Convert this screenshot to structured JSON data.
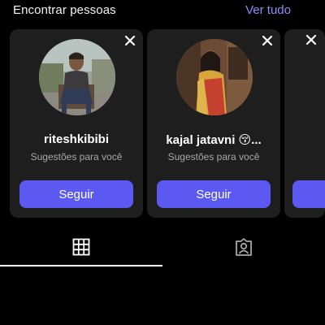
{
  "header": {
    "title": "Encontrar pessoas",
    "see_all": "Ver tudo"
  },
  "suggestions": [
    {
      "username": "riteshkibibi",
      "subtitle": "Sugestões para você",
      "button_label": "Seguir"
    },
    {
      "username": "kajal jatavni 😚...",
      "subtitle": "Sugestões para você",
      "button_label": "Seguir"
    }
  ],
  "colors": {
    "accent": "#5c59f2",
    "link": "#8d8cf8",
    "card_bg": "#1e1e1e",
    "background": "#000000",
    "muted_text": "#a8a8a8"
  },
  "tabs": [
    {
      "icon": "grid-icon",
      "active": true
    },
    {
      "icon": "tagged-person-icon",
      "active": false
    }
  ]
}
